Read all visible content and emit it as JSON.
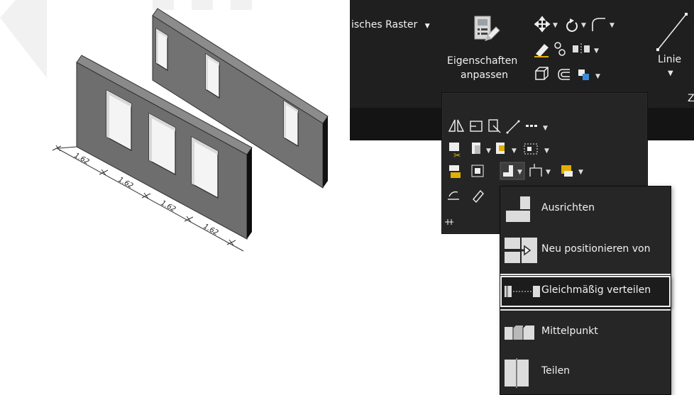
{
  "drawing": {
    "dimension_labels": [
      "1.62",
      "1.62",
      "1.62",
      "1.62"
    ]
  },
  "ribbon": {
    "raster_label": "isches Raster",
    "eigenschaften_line1": "Eigenschaften",
    "eigenschaften_line2": "anpassen",
    "linie_label": "Linie",
    "panel_letter": "Z"
  },
  "menu": {
    "items": [
      {
        "label": "Ausrichten",
        "icon": "align-icon"
      },
      {
        "label": "Neu positionieren von",
        "icon": "reposition-arrow-icon"
      },
      {
        "label": "Gleichmäßig verteilen",
        "icon": "distribute-evenly-icon"
      },
      {
        "label": "Mittelpunkt",
        "icon": "midpoint-icon"
      },
      {
        "label": "Teilen",
        "icon": "divide-icon"
      }
    ]
  },
  "colors": {
    "ribbon_bg": "#1f1f1f",
    "menu_bg": "#262626",
    "wall_face": "#6f6f6f",
    "wall_top": "#8a8a8a",
    "wall_side": "#111111",
    "window": "#f4f4f4"
  }
}
